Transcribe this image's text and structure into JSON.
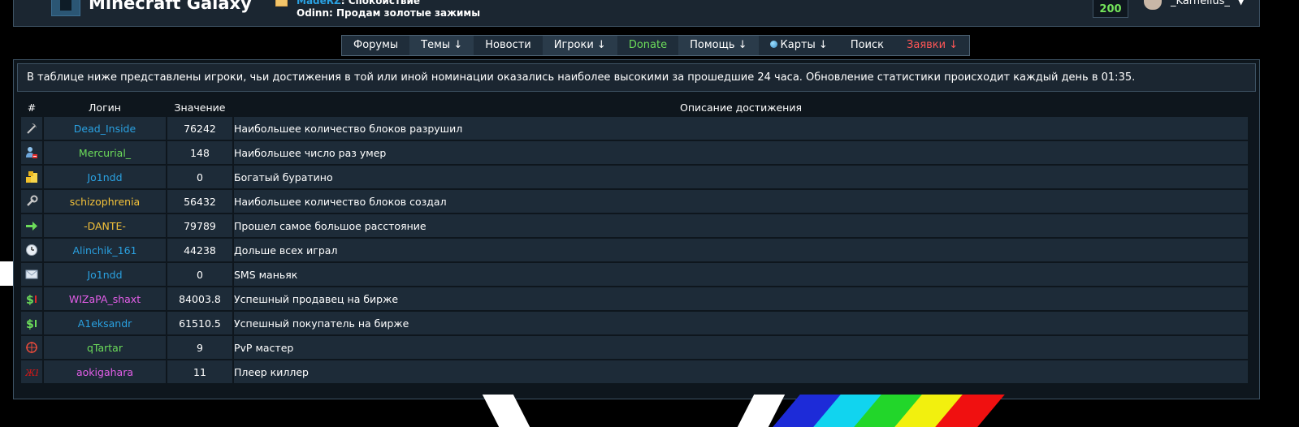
{
  "header": {
    "site_title": "Minecraft Galaxy",
    "ticker": [
      {
        "name": "MadeRZ",
        "sep": ": ",
        "text": "Спокойствие",
        "name_color": "#2aa1e1"
      },
      {
        "name": "Odinn",
        "sep": ": ",
        "text": "Продам золотые зажимы",
        "name_color": "#ffffff"
      }
    ],
    "counter": "200",
    "username": "_Karnelius_",
    "dropdown_arrow": "▼"
  },
  "nav": [
    {
      "label": "Форумы",
      "style": "normal"
    },
    {
      "label": "Темы ↓",
      "style": "alt"
    },
    {
      "label": "Новости",
      "style": "normal"
    },
    {
      "label": "Игроки ↓",
      "style": "alt"
    },
    {
      "label": "Donate",
      "style": "green"
    },
    {
      "label": "Помощь ↓",
      "style": "alt"
    },
    {
      "label": "Карты ↓",
      "style": "normal",
      "icon": "globe-icon"
    },
    {
      "label": "Поиск",
      "style": "normal"
    },
    {
      "label": "Заявки ↓",
      "style": "red"
    }
  ],
  "info_text": "В таблице ниже представлены игроки, чьи достижения в той или иной номинации оказались наиболее высокими за прошедшие 24 часа. Обновление статистики происходит каждый день в 01:35.",
  "table": {
    "headers": [
      "#",
      "Логин",
      "Значение",
      "Описание достижения"
    ],
    "rows": [
      {
        "icon": "pickaxe-icon",
        "login": "Dead_Inside",
        "color": "#2aa1e1",
        "value": "76242",
        "desc": "Наибольшее количество блоков разрушил"
      },
      {
        "icon": "user-remove-icon",
        "login": "Mercurial_",
        "color": "#6cdc5a",
        "value": "148",
        "desc": "Наибольшее число раз умер"
      },
      {
        "icon": "coins-icon",
        "login": "Jo1ndd",
        "color": "#2aa1e1",
        "value": "0",
        "desc": "Богатый буратино"
      },
      {
        "icon": "wrench-icon",
        "login": "schizophrenia",
        "color": "#f4c23a",
        "value": "56432",
        "desc": "Наибольшее количество блоков создал"
      },
      {
        "icon": "arrow-right-icon",
        "login": "-DANTE-",
        "color": "#f4c23a",
        "value": "79789",
        "desc": "Прошел самое большое расстояние"
      },
      {
        "icon": "clock-icon",
        "login": "Alinchik_161",
        "color": "#2aa1e1",
        "value": "44238",
        "desc": "Дольше всех играл"
      },
      {
        "icon": "envelope-icon",
        "login": "Jo1ndd",
        "color": "#2aa1e1",
        "value": "0",
        "desc": "SMS маньяк"
      },
      {
        "icon": "dollar-down-icon",
        "login": "WIZaPA_shaxt",
        "color": "#e35ee8",
        "value": "84003.8",
        "desc": "Успешный продавец на бирже"
      },
      {
        "icon": "dollar-up-icon",
        "login": "A1eksandr",
        "color": "#2aa1e1",
        "value": "61510.5",
        "desc": "Успешный покупатель на бирже"
      },
      {
        "icon": "crosshair-icon",
        "login": "qTartar",
        "color": "#6cdc5a",
        "value": "9",
        "desc": "PvP мастер"
      },
      {
        "icon": "killer-icon",
        "login": "aokigahara",
        "color": "#e35ee8",
        "value": "11",
        "desc": "Плеер киллер"
      }
    ]
  },
  "colors": {
    "panel_bg": "#1b2631",
    "cell_bg": "#1d2b38",
    "border": "#3e5364",
    "accent_green": "#6cdc5a",
    "accent_red": "#ff5656"
  }
}
